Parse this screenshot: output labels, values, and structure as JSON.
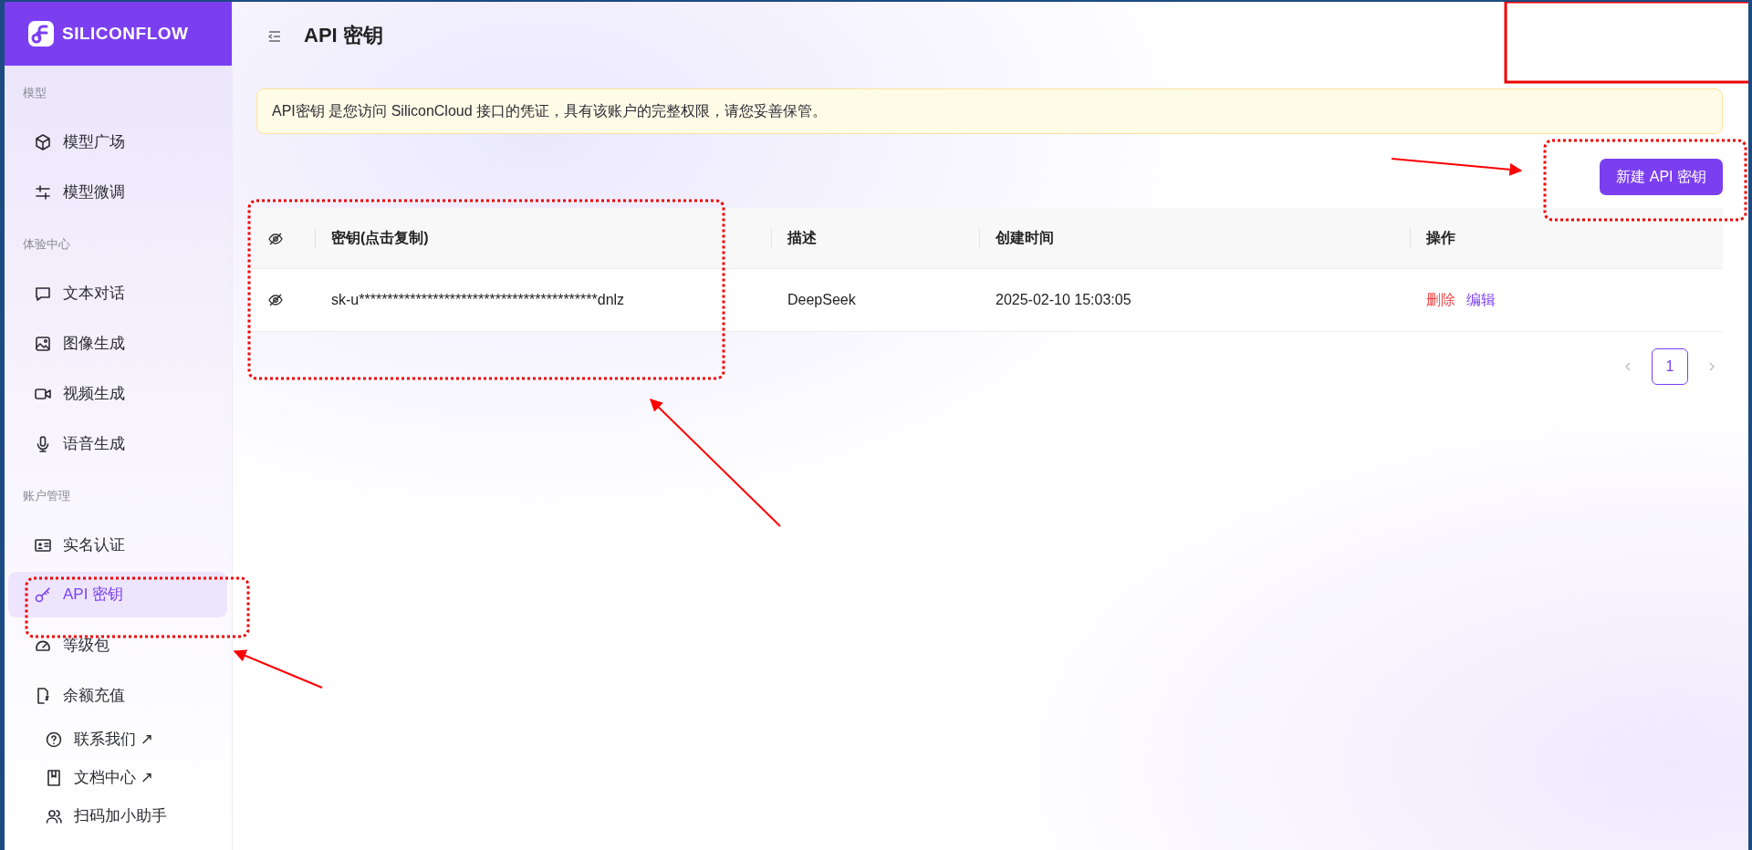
{
  "logo": {
    "text": "SILICONFLOW"
  },
  "sidebar": {
    "sections": [
      {
        "title": "模型",
        "items": [
          {
            "label": "模型广场",
            "selected": false
          },
          {
            "label": "模型微调",
            "selected": false
          }
        ]
      },
      {
        "title": "体验中心",
        "items": [
          {
            "label": "文本对话",
            "selected": false
          },
          {
            "label": "图像生成",
            "selected": false
          },
          {
            "label": "视频生成",
            "selected": false
          },
          {
            "label": "语音生成",
            "selected": false
          }
        ]
      },
      {
        "title": "账户管理",
        "items": [
          {
            "label": "实名认证",
            "selected": false
          },
          {
            "label": "API 密钥",
            "selected": true
          },
          {
            "label": "等级包",
            "selected": false
          },
          {
            "label": "余额充值",
            "selected": false
          }
        ]
      }
    ],
    "links": [
      {
        "label": "联系我们 ↗"
      },
      {
        "label": "文档中心 ↗"
      },
      {
        "label": "扫码加小助手"
      }
    ]
  },
  "header": {
    "title": "API 密钥"
  },
  "alert": {
    "text": "API密钥 是您访问 SiliconCloud 接口的凭证，具有该账户的完整权限，请您妥善保管。"
  },
  "new_key_button": {
    "label": "新建 API 密钥"
  },
  "table": {
    "columns": [
      "密钥(点击复制)",
      "描述",
      "创建时间",
      "操作"
    ],
    "rows": [
      {
        "key": "sk-u******************************************dnlz",
        "description": "DeepSeek",
        "created": "2025-02-10 15:03:05",
        "actions": [
          {
            "label": "删除",
            "kind": "danger"
          },
          {
            "label": "编辑",
            "kind": "primary"
          }
        ]
      }
    ]
  },
  "pagination": {
    "pages": [
      {
        "label": "1",
        "selected": true
      }
    ]
  }
}
